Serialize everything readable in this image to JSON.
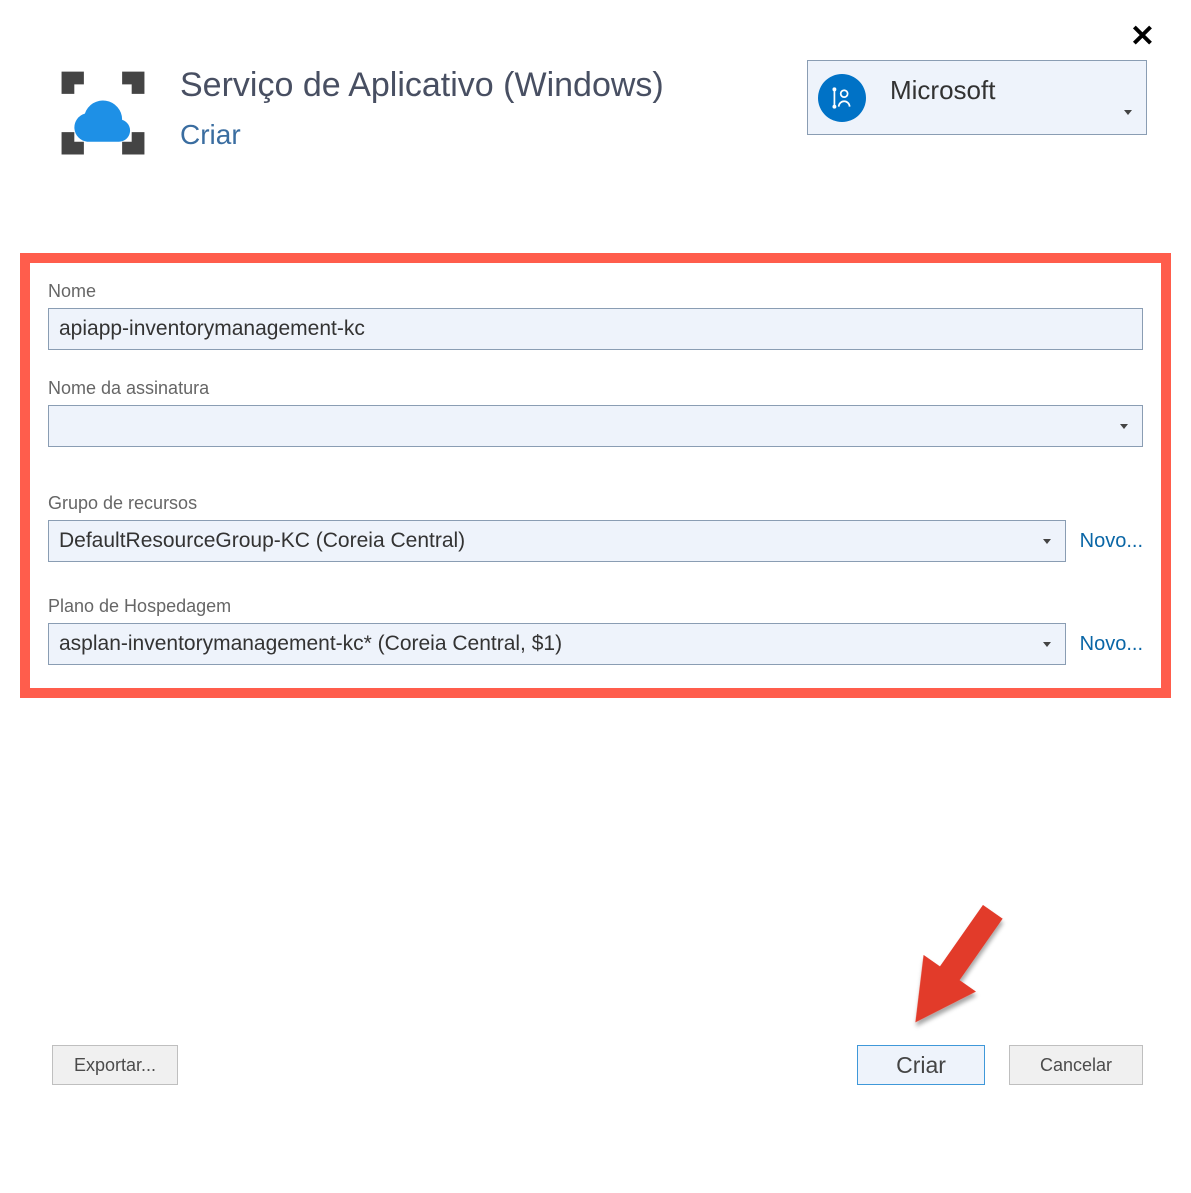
{
  "header": {
    "title": "Serviço de Aplicativo (Windows)",
    "subtitle": "Criar"
  },
  "account": {
    "label": "Microsoft"
  },
  "form": {
    "nome": {
      "label": "Nome",
      "value": "apiapp-inventorymanagement-kc"
    },
    "subscription": {
      "label": "Nome da assinatura",
      "value": ""
    },
    "resourceGroup": {
      "label": "Grupo de recursos",
      "value": "DefaultResourceGroup-KC (Coreia Central)",
      "newLink": "Novo..."
    },
    "hostingPlan": {
      "label": "Plano de Hospedagem",
      "value": "asplan-inventorymanagement-kc* (Coreia Central, $1)",
      "newLink": "Novo..."
    }
  },
  "buttons": {
    "export": "Exportar...",
    "create": "Criar",
    "cancel": "Cancelar"
  }
}
